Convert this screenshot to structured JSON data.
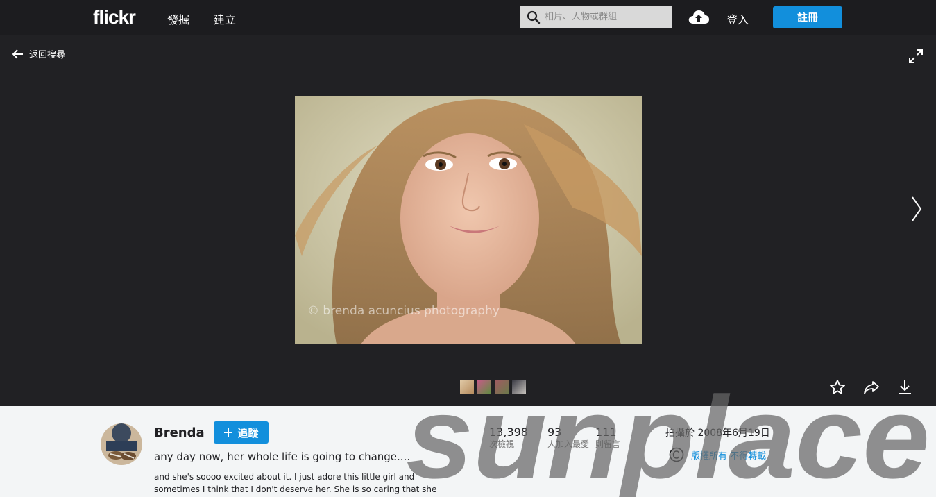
{
  "header": {
    "logo": "flickr",
    "nav": [
      "發掘",
      "建立"
    ],
    "search_placeholder": "相片、人物或群組",
    "login": "登入",
    "signup": "註冊"
  },
  "stage": {
    "back_label": "返回搜尋",
    "photo_watermark": "© brenda acuncius photography"
  },
  "info": {
    "author": "Brenda",
    "follow_label": "追蹤",
    "title": "any day now, her whole life is going to change....",
    "description": "and she's soooo excited about it. I just adore this little girl and sometimes I think that I don't deserve her. She is so caring that she",
    "stats": [
      {
        "num": "13,398",
        "label": "次檢視"
      },
      {
        "num": "93",
        "label": "人加入最愛"
      },
      {
        "num": "111",
        "label": "則留言"
      }
    ],
    "taken": "拍攝於 2008年6月19日",
    "license": "版權所有 不得轉載"
  },
  "overlay": {
    "watermark": "sunplace"
  },
  "colors": {
    "nav_bg": "#1c1c1f",
    "stage_bg": "#212124",
    "accent": "#128fdc"
  }
}
